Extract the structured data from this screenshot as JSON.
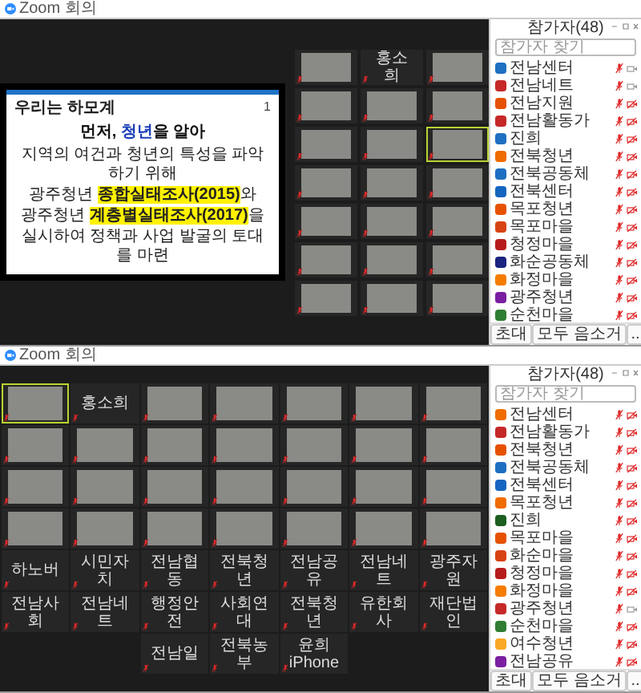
{
  "windows": [
    {
      "title": "Zoom 회의",
      "kind": "share",
      "slide": {
        "header": "우리는 하모계",
        "page": "1",
        "heading": "먼저, **청년**을 알아",
        "lines": [
          "지역의 여건과 청년의 특성을 파악하기 위해",
          "광주청년 **종합실태조사(2015)**와",
          "광주청년 **계층별실태조사(2017)**을",
          "실시하여 정책과 사업 발굴의 토대를 마련"
        ]
      },
      "tiles": [
        {
          "kind": "video",
          "speaking": false
        },
        {
          "kind": "name",
          "name": "홍소희",
          "speaking": false
        },
        {
          "kind": "video",
          "speaking": false
        },
        {
          "kind": "video",
          "speaking": false
        },
        {
          "kind": "video",
          "speaking": false
        },
        {
          "kind": "video",
          "speaking": false
        },
        {
          "kind": "video",
          "speaking": false
        },
        {
          "kind": "video",
          "speaking": false
        },
        {
          "kind": "video",
          "speaking": true
        },
        {
          "kind": "video",
          "speaking": false
        },
        {
          "kind": "video",
          "speaking": false
        },
        {
          "kind": "video",
          "speaking": false
        },
        {
          "kind": "video",
          "speaking": false
        },
        {
          "kind": "video",
          "speaking": false
        },
        {
          "kind": "video",
          "speaking": false
        },
        {
          "kind": "video",
          "speaking": false
        },
        {
          "kind": "video",
          "speaking": false
        },
        {
          "kind": "video",
          "speaking": false
        },
        {
          "kind": "video",
          "speaking": false
        },
        {
          "kind": "video",
          "speaking": false
        },
        {
          "kind": "video",
          "speaking": false
        }
      ],
      "panel": {
        "title": "참가자(48)",
        "search_placeholder": "참가자 찾기",
        "buttons": [
          "초대",
          "모두 음소거",
          "..."
        ],
        "participants": [
          {
            "name": "전남센터",
            "color": "#1e6fc2",
            "video_off": false
          },
          {
            "name": "전남네트",
            "color": "#c62828",
            "video_off": false
          },
          {
            "name": "전남지원",
            "color": "#e65100",
            "video_off": true
          },
          {
            "name": "전남활동가",
            "color": "#c62828",
            "video_off": true
          },
          {
            "name": "진희",
            "color": "#1e6fc2",
            "video_off": true
          },
          {
            "name": "전북청년",
            "color": "#ef6c00",
            "video_off": true
          },
          {
            "name": "전북공동체",
            "color": "#1e6fc2",
            "video_off": true
          },
          {
            "name": "전북센터",
            "color": "#1565c0",
            "video_off": true
          },
          {
            "name": "목포청년",
            "color": "#e65100",
            "video_off": true
          },
          {
            "name": "목포마을",
            "color": "#d84315",
            "video_off": true
          },
          {
            "name": "청정마을",
            "color": "#b71c1c",
            "video_off": true
          },
          {
            "name": "화순공동체",
            "color": "#1a237e",
            "video_off": true
          },
          {
            "name": "화정마을",
            "color": "#f57c00",
            "video_off": true
          },
          {
            "name": "광주청년",
            "color": "#7b1fa2",
            "video_off": true
          },
          {
            "name": "순천마을",
            "color": "#2e7d32",
            "video_off": true
          }
        ]
      }
    },
    {
      "title": "Zoom 회의",
      "kind": "gallery",
      "tiles": [
        {
          "kind": "video",
          "speaking": true
        },
        {
          "kind": "name",
          "name": "홍소희",
          "speaking": false
        },
        {
          "kind": "video",
          "speaking": false
        },
        {
          "kind": "video",
          "speaking": false
        },
        {
          "kind": "video",
          "speaking": false
        },
        {
          "kind": "video",
          "speaking": false
        },
        {
          "kind": "video",
          "speaking": false
        },
        {
          "kind": "video",
          "speaking": false
        },
        {
          "kind": "video",
          "speaking": false
        },
        {
          "kind": "video",
          "speaking": false
        },
        {
          "kind": "video",
          "speaking": false
        },
        {
          "kind": "video",
          "speaking": false
        },
        {
          "kind": "video",
          "speaking": false
        },
        {
          "kind": "video",
          "speaking": false
        },
        {
          "kind": "video",
          "speaking": false
        },
        {
          "kind": "video",
          "speaking": false
        },
        {
          "kind": "video",
          "speaking": false
        },
        {
          "kind": "video",
          "speaking": false
        },
        {
          "kind": "video",
          "speaking": false
        },
        {
          "kind": "video",
          "speaking": false
        },
        {
          "kind": "video",
          "speaking": false
        },
        {
          "kind": "video",
          "speaking": false
        },
        {
          "kind": "video",
          "speaking": false
        },
        {
          "kind": "video",
          "speaking": false
        },
        {
          "kind": "video",
          "speaking": false
        },
        {
          "kind": "video",
          "speaking": false
        },
        {
          "kind": "video",
          "speaking": false
        },
        {
          "kind": "video",
          "speaking": false
        },
        {
          "kind": "name",
          "name": "하노버",
          "speaking": false
        },
        {
          "kind": "name",
          "name": "시민자치",
          "speaking": false
        },
        {
          "kind": "name",
          "name": "전남협동",
          "speaking": false
        },
        {
          "kind": "name",
          "name": "전북청년",
          "speaking": false
        },
        {
          "kind": "name",
          "name": "전남공유",
          "speaking": false
        },
        {
          "kind": "name",
          "name": "전남네트",
          "speaking": false
        },
        {
          "kind": "name",
          "name": "광주자원",
          "speaking": false
        },
        {
          "kind": "name",
          "name": "전남사회",
          "speaking": false
        },
        {
          "kind": "name",
          "name": "전남네트",
          "speaking": false
        },
        {
          "kind": "name",
          "name": "행정안전",
          "speaking": false
        },
        {
          "kind": "name",
          "name": "사회연대",
          "speaking": false
        },
        {
          "kind": "name",
          "name": "전북청년",
          "speaking": false
        },
        {
          "kind": "name",
          "name": "유한회사",
          "speaking": false
        },
        {
          "kind": "name",
          "name": "재단법인",
          "speaking": false
        },
        {
          "kind": "empty"
        },
        {
          "kind": "empty"
        },
        {
          "kind": "name",
          "name": "전남일",
          "speaking": false
        },
        {
          "kind": "name",
          "name": "전북농부",
          "speaking": false
        },
        {
          "kind": "name",
          "name": "윤희 iPhone",
          "speaking": false
        }
      ],
      "panel": {
        "title": "참가자(48)",
        "search_placeholder": "참가자 찾기",
        "buttons": [
          "초대",
          "모두 음소거",
          "..."
        ],
        "participants": [
          {
            "name": "전남센터",
            "color": "#ef6c00",
            "video_off": true
          },
          {
            "name": "전남활동가",
            "color": "#c62828",
            "video_off": true
          },
          {
            "name": "전북청년",
            "color": "#e65100",
            "video_off": true
          },
          {
            "name": "전북공동체",
            "color": "#1e6fc2",
            "video_off": true
          },
          {
            "name": "전북센터",
            "color": "#1565c0",
            "video_off": true
          },
          {
            "name": "목포청년",
            "color": "#ef6c00",
            "video_off": true
          },
          {
            "name": "진희",
            "color": "#1b5e20",
            "video_off": true
          },
          {
            "name": "목포마을",
            "color": "#e65100",
            "video_off": true
          },
          {
            "name": "화순마을",
            "color": "#d84315",
            "video_off": true
          },
          {
            "name": "청정마을",
            "color": "#b71c1c",
            "video_off": true
          },
          {
            "name": "화정마을",
            "color": "#f57c00",
            "video_off": true
          },
          {
            "name": "광주청년",
            "color": "#c62828",
            "video_off": false
          },
          {
            "name": "순천마을",
            "color": "#2e7d32",
            "video_off": true
          },
          {
            "name": "여수청년",
            "color": "#f9a825",
            "video_off": true
          },
          {
            "name": "전남공유",
            "color": "#7b1fa2",
            "video_off": true
          }
        ]
      }
    }
  ]
}
